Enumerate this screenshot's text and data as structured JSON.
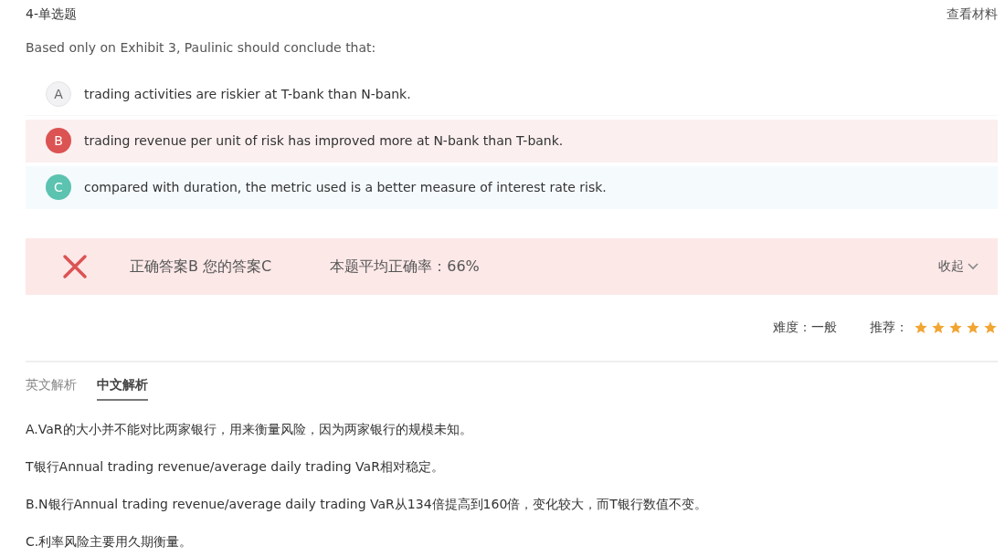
{
  "header": {
    "title": "4-单选题",
    "link": "查看材料"
  },
  "question": "Based only on Exhibit 3, Paulinic should conclude that:",
  "options": [
    {
      "letter": "A",
      "text": "trading activities are riskier at T-bank than N-bank.",
      "kind": "plain"
    },
    {
      "letter": "B",
      "text": "trading revenue per unit of risk has improved more at N-bank than T-bank.",
      "kind": "correct"
    },
    {
      "letter": "C",
      "text": "compared with duration, the metric used is a better measure of interest rate risk.",
      "kind": "chosen"
    }
  ],
  "result": {
    "is_correct": false,
    "answers": "正确答案B 您的答案C",
    "accuracy": "本题平均正确率：66%",
    "toggle": "收起",
    "expanded": true
  },
  "meta": {
    "difficulty": "难度：一般",
    "recommend_label": "推荐：",
    "stars": 5
  },
  "tabs": [
    {
      "label": "英文解析",
      "selected": false
    },
    {
      "label": "中文解析",
      "selected": true
    }
  ],
  "analysis": [
    "A.VaR的大小并不能对比两家银行，用来衡量风险，因为两家银行的规模未知。",
    "T银行Annual trading revenue/average daily trading VaR相对稳定。",
    "B.N银行Annual trading revenue/average daily trading VaR从134倍提高到160倍，变化较大，而T银行数值不变。",
    "C.利率风险主要用久期衡量。"
  ]
}
